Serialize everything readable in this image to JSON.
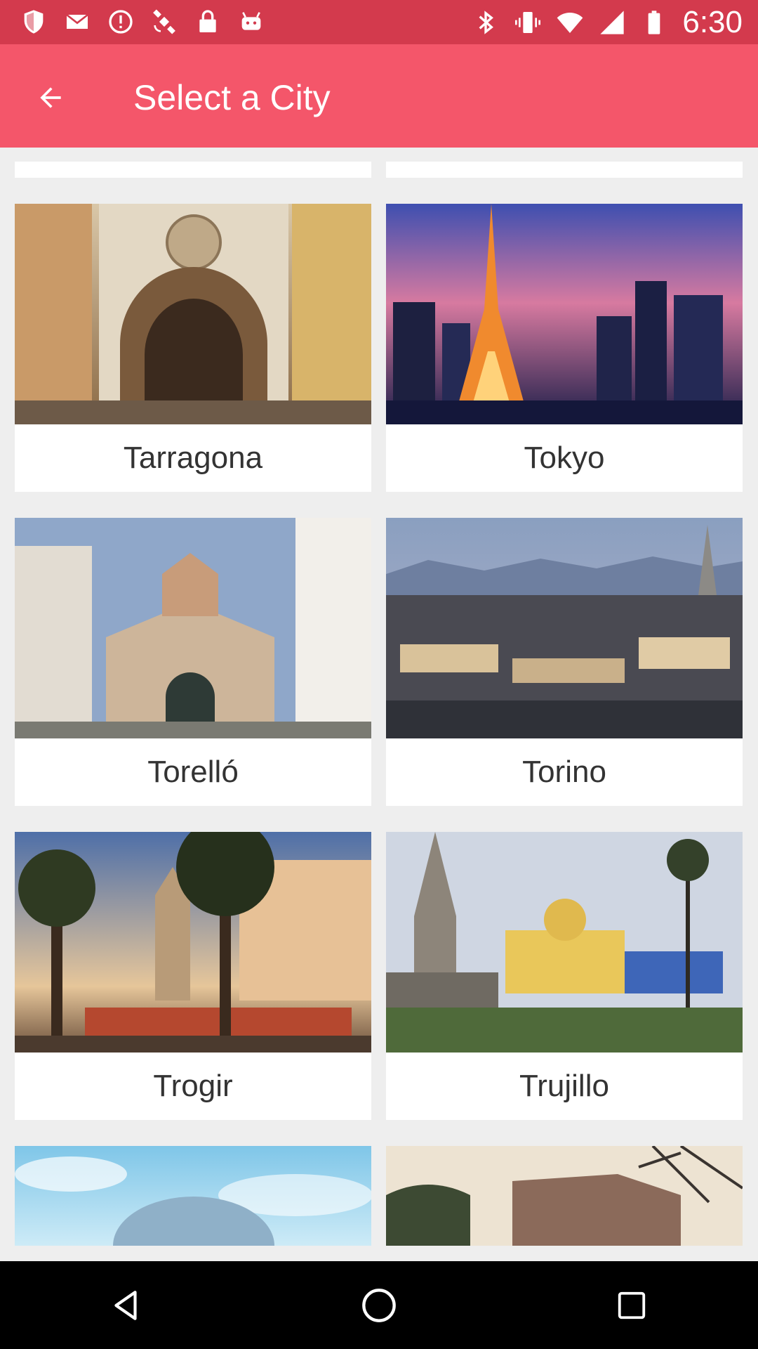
{
  "status_bar": {
    "time": "6:30",
    "left_icons": [
      "shield-icon",
      "mail-icon",
      "alert-icon",
      "satellite-icon",
      "lock-icon",
      "android-icon"
    ],
    "right_icons": [
      "bluetooth-icon",
      "vibrate-icon",
      "wifi-icon",
      "signal-icon",
      "battery-icon"
    ]
  },
  "app_bar": {
    "title": "Select a City",
    "back_icon": "arrow-back-icon"
  },
  "cities": [
    {
      "name": "Tarragona"
    },
    {
      "name": "Tokyo"
    },
    {
      "name": "Torelló"
    },
    {
      "name": "Torino"
    },
    {
      "name": "Trogir"
    },
    {
      "name": "Trujillo"
    }
  ],
  "nav_bar": {
    "icons": [
      "back-triangle-icon",
      "home-circle-icon",
      "recents-square-icon"
    ]
  },
  "colors": {
    "status_bar": "#D33A4D",
    "app_bar": "#F4566A",
    "background": "#EEEEEE"
  }
}
